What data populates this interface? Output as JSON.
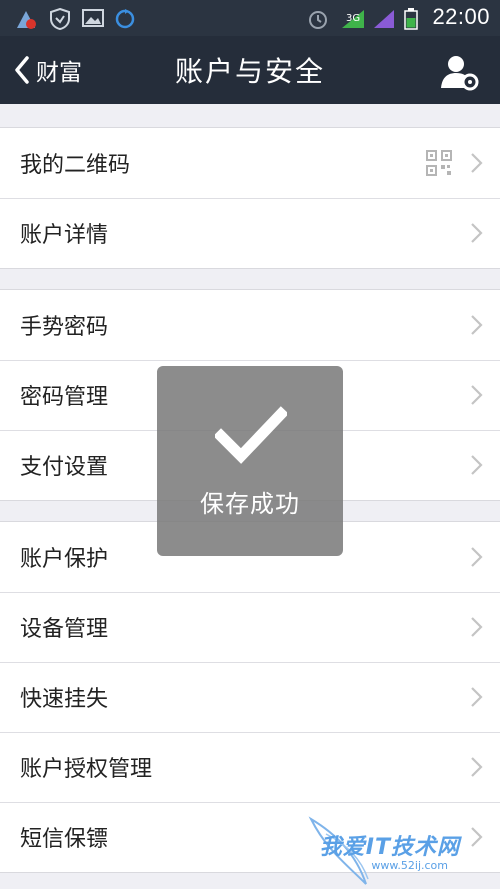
{
  "status_bar": {
    "time": "22:00",
    "icons": [
      "app-update-icon",
      "shield-icon",
      "image-icon",
      "sync-icon",
      "alarm-icon",
      "network-icon",
      "signal-icon",
      "battery-icon"
    ]
  },
  "nav": {
    "back_label": "财富",
    "title": "账户与安全",
    "right_icon": "user-settings-icon"
  },
  "groups": [
    {
      "items": [
        {
          "label": "我的二维码",
          "accessory": "qr-code-icon"
        },
        {
          "label": "账户详情"
        }
      ]
    },
    {
      "items": [
        {
          "label": "手势密码"
        },
        {
          "label": "密码管理"
        },
        {
          "label": "支付设置"
        }
      ]
    },
    {
      "items": [
        {
          "label": "账户保护"
        },
        {
          "label": "设备管理"
        },
        {
          "label": "快速挂失"
        },
        {
          "label": "账户授权管理"
        },
        {
          "label": "短信保镖"
        }
      ]
    }
  ],
  "toast": {
    "message": "保存成功",
    "icon": "check-icon"
  },
  "watermark": {
    "text": "我爱IT技术网",
    "url": "www.52ij.com"
  },
  "colors": {
    "nav_bg": "#252d3a",
    "page_bg": "#efeff4",
    "toast_bg": "#787878"
  }
}
